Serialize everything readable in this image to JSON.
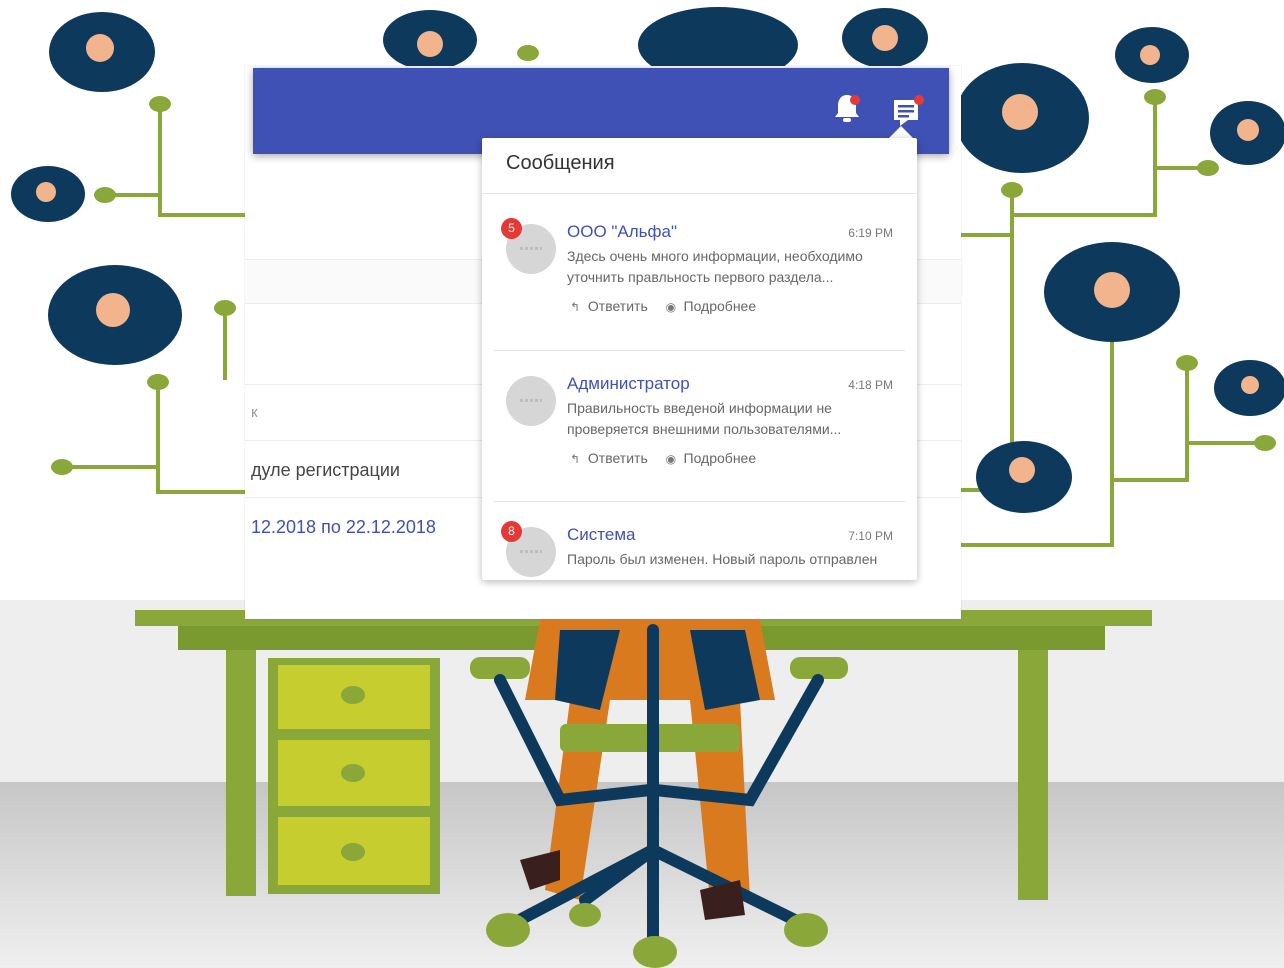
{
  "app": {
    "background_rows": [
      {
        "text": ""
      },
      {
        "text": ""
      },
      {
        "text": "к"
      },
      {
        "text": "дуле регистрации"
      },
      {
        "text": "12.2018 по 22.12.2018"
      }
    ],
    "toolbar": {
      "notifications_icon": "bell-icon",
      "messages_icon": "chat-icon"
    }
  },
  "messages_panel": {
    "title": "Сообщения",
    "reply_label": "Ответить",
    "details_label": "Подробнее",
    "messages": [
      {
        "sender": "ООО \"Альфа\"",
        "time": "6:19 PM",
        "badge": "5",
        "text": "Здесь очень много информации, необходимо уточнить правльность первого раздела..."
      },
      {
        "sender": "Администратор",
        "time": "4:18 PM",
        "badge": "",
        "text": "Правильность введеной информации не проверяется внешними пользователями..."
      },
      {
        "sender": "Система",
        "time": "7:10 PM",
        "badge": "8",
        "text": "Пароль был изменен. Новый пароль отправлен"
      }
    ]
  },
  "colors": {
    "primary": "#3f51b5",
    "badge": "#e53935",
    "illustration_green": "#8aa83a",
    "avatar_bg": "#0d3a5c"
  }
}
